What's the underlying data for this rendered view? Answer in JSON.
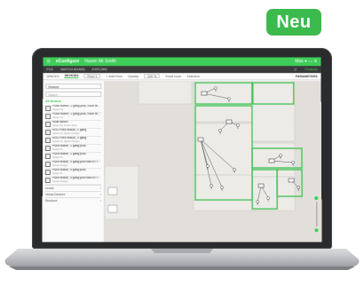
{
  "badge": {
    "label": "Neu"
  },
  "app": {
    "brand": "eConfigure",
    "project": "Haven Mr Smith",
    "window_controls": "Max ▾ — ✕"
  },
  "menubar": {
    "items": [
      "FILE",
      "SWITCH BOARD",
      "EXPLORE"
    ],
    "account": "Products"
  },
  "toolbar": {
    "tabs": [
      "SPACES",
      "DEVICES"
    ],
    "floor_select": "Floor 1",
    "add_floor": "+ Add Floor",
    "opacity_label": "Opacity",
    "opacity_value": "100 %",
    "show_label": "Show room",
    "devices_label": "Selection",
    "params": "PARAMETERS"
  },
  "sidebar": {
    "select": "Devices",
    "search_placeholder": "Search...",
    "section": "All devices",
    "items": [
      {
        "name": "Push button, 1 gang plus, room te…",
        "sub": "System M"
      },
      {
        "name": "Push button, 1 gang plus, room te…",
        "sub": "System M"
      },
      {
        "name": "Multi switch",
        "sub": "System M, Smart Home"
      },
      {
        "name": "KNX Push button, 1 gang",
        "sub": "System M, System Design"
      },
      {
        "name": "KNX Push button, 2 gang",
        "sub": "System M, System Design"
      },
      {
        "name": "Push button, 1 gang plus",
        "sub": "System M"
      },
      {
        "name": "Push button, 1 gang plus",
        "sub": "System M"
      },
      {
        "name": "Push button, 4 gang plus with IR r…",
        "sub": "System Design"
      },
      {
        "name": "Push button, 4 gang plus",
        "sub": "System M"
      },
      {
        "name": "Push button, 4 gang plus with IR r…",
        "sub": "System Design"
      }
    ],
    "footer": [
      {
        "label": "Levels",
        "icon": "chevron-right-icon"
      },
      {
        "label": "Virtual Devices",
        "icon": "chevron-right-icon"
      },
      {
        "label": "Structure",
        "icon": "chevron-right-icon"
      }
    ]
  },
  "colors": {
    "accent": "#3dcd58",
    "badge": "#3dba4e",
    "dark_bar": "#3a3a3a",
    "room_border": "#49c35a"
  }
}
